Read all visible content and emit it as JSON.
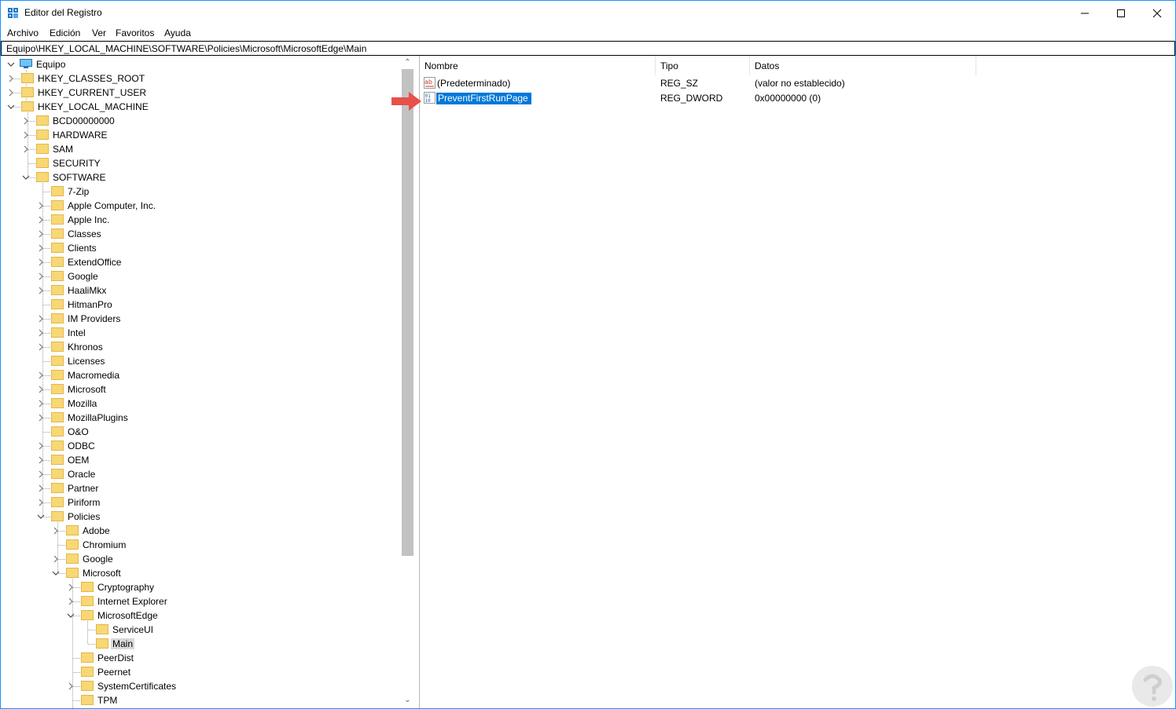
{
  "window": {
    "title": "Editor del Registro",
    "accent": "#1e90ff"
  },
  "menu": [
    "Archivo",
    "Edición",
    "Ver",
    "Favoritos",
    "Ayuda"
  ],
  "address": "Equipo\\HKEY_LOCAL_MACHINE\\SOFTWARE\\Policies\\Microsoft\\MicrosoftEdge\\Main",
  "tree": [
    {
      "label": "Equipo",
      "depth": 0,
      "toggle": "expanded",
      "icon": "computer-icon"
    },
    {
      "label": "HKEY_CLASSES_ROOT",
      "depth": 1,
      "toggle": "collapsed"
    },
    {
      "label": "HKEY_CURRENT_USER",
      "depth": 1,
      "toggle": "collapsed"
    },
    {
      "label": "HKEY_LOCAL_MACHINE",
      "depth": 1,
      "toggle": "expanded"
    },
    {
      "label": "BCD00000000",
      "depth": 2,
      "toggle": "collapsed"
    },
    {
      "label": "HARDWARE",
      "depth": 2,
      "toggle": "collapsed"
    },
    {
      "label": "SAM",
      "depth": 2,
      "toggle": "collapsed"
    },
    {
      "label": "SECURITY",
      "depth": 2,
      "toggle": "none"
    },
    {
      "label": "SOFTWARE",
      "depth": 2,
      "toggle": "expanded"
    },
    {
      "label": "7-Zip",
      "depth": 3,
      "toggle": "none"
    },
    {
      "label": "Apple Computer, Inc.",
      "depth": 3,
      "toggle": "collapsed"
    },
    {
      "label": "Apple Inc.",
      "depth": 3,
      "toggle": "collapsed"
    },
    {
      "label": "Classes",
      "depth": 3,
      "toggle": "collapsed"
    },
    {
      "label": "Clients",
      "depth": 3,
      "toggle": "collapsed"
    },
    {
      "label": "ExtendOffice",
      "depth": 3,
      "toggle": "collapsed"
    },
    {
      "label": "Google",
      "depth": 3,
      "toggle": "collapsed"
    },
    {
      "label": "HaaliMkx",
      "depth": 3,
      "toggle": "collapsed"
    },
    {
      "label": "HitmanPro",
      "depth": 3,
      "toggle": "none"
    },
    {
      "label": "IM Providers",
      "depth": 3,
      "toggle": "collapsed"
    },
    {
      "label": "Intel",
      "depth": 3,
      "toggle": "collapsed"
    },
    {
      "label": "Khronos",
      "depth": 3,
      "toggle": "collapsed"
    },
    {
      "label": "Licenses",
      "depth": 3,
      "toggle": "none"
    },
    {
      "label": "Macromedia",
      "depth": 3,
      "toggle": "collapsed"
    },
    {
      "label": "Microsoft",
      "depth": 3,
      "toggle": "collapsed"
    },
    {
      "label": "Mozilla",
      "depth": 3,
      "toggle": "collapsed"
    },
    {
      "label": "MozillaPlugins",
      "depth": 3,
      "toggle": "collapsed"
    },
    {
      "label": "O&O",
      "depth": 3,
      "toggle": "none"
    },
    {
      "label": "ODBC",
      "depth": 3,
      "toggle": "collapsed"
    },
    {
      "label": "OEM",
      "depth": 3,
      "toggle": "collapsed"
    },
    {
      "label": "Oracle",
      "depth": 3,
      "toggle": "collapsed"
    },
    {
      "label": "Partner",
      "depth": 3,
      "toggle": "collapsed"
    },
    {
      "label": "Piriform",
      "depth": 3,
      "toggle": "collapsed"
    },
    {
      "label": "Policies",
      "depth": 3,
      "toggle": "expanded"
    },
    {
      "label": "Adobe",
      "depth": 4,
      "toggle": "collapsed"
    },
    {
      "label": "Chromium",
      "depth": 4,
      "toggle": "none"
    },
    {
      "label": "Google",
      "depth": 4,
      "toggle": "collapsed"
    },
    {
      "label": "Microsoft",
      "depth": 4,
      "toggle": "expanded"
    },
    {
      "label": "Cryptography",
      "depth": 5,
      "toggle": "collapsed"
    },
    {
      "label": "Internet Explorer",
      "depth": 5,
      "toggle": "collapsed"
    },
    {
      "label": "MicrosoftEdge",
      "depth": 5,
      "toggle": "expanded"
    },
    {
      "label": "ServiceUI",
      "depth": 6,
      "toggle": "none"
    },
    {
      "label": "Main",
      "depth": 6,
      "toggle": "none",
      "selected": true
    },
    {
      "label": "PeerDist",
      "depth": 5,
      "toggle": "none"
    },
    {
      "label": "Peernet",
      "depth": 5,
      "toggle": "none"
    },
    {
      "label": "SystemCertificates",
      "depth": 5,
      "toggle": "collapsed"
    },
    {
      "label": "TPM",
      "depth": 5,
      "toggle": "none"
    }
  ],
  "list": {
    "columns": [
      "Nombre",
      "Tipo",
      "Datos"
    ],
    "rows": [
      {
        "name": "(Predeterminado)",
        "type": "REG_SZ",
        "data": "(valor no establecido)",
        "icon": "string-value-icon",
        "selected": false
      },
      {
        "name": "PreventFirstRunPage",
        "type": "REG_DWORD",
        "data": "0x00000000 (0)",
        "icon": "dword-value-icon",
        "selected": true
      }
    ]
  },
  "colors": {
    "selection": "#0078d7",
    "tree_selection": "#d9d9d9",
    "folder": "#f8d775",
    "arrow": "#e8504a"
  }
}
